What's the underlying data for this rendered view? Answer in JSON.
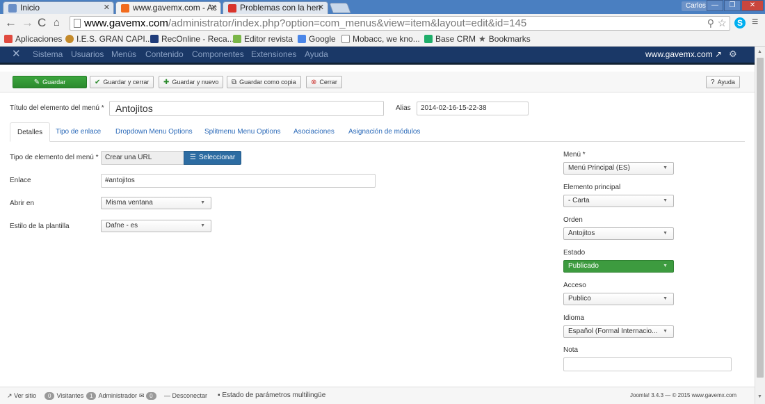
{
  "browser": {
    "tabs": [
      {
        "title": "Inicio",
        "fav_color": "#6a8fc7"
      },
      {
        "title": "www.gavemx.com - Ac",
        "fav_color": "#f26b1d"
      },
      {
        "title": "Problemas con la herr",
        "fav_color": "#d9342b"
      }
    ],
    "user": "Carlos",
    "window_buttons": [
      "—",
      "❐",
      "✕"
    ],
    "url_host": "www.gavemx.com",
    "url_rest": "/administrator/index.php?option=com_menus&view=item&layout=edit&id=145",
    "skype_label": "S",
    "bookmarks": [
      {
        "label": "Aplicaciones",
        "color": "#e04a3f"
      },
      {
        "label": "I.E.S. GRAN CAPI...",
        "color": "#c48a2a"
      },
      {
        "label": "RecOnline - Reca...",
        "color": "#1f3c7a"
      },
      {
        "label": "Editor revista",
        "color": "#7ab648"
      },
      {
        "label": "Google",
        "color": "#4a86e8"
      },
      {
        "label": "Mobacc, we kno...",
        "color": "#ffffff"
      },
      {
        "label": "Base CRM",
        "color": "#1fae6a"
      },
      {
        "label": "Bookmarks",
        "color": "#555555"
      }
    ]
  },
  "admin_nav": {
    "items": [
      "Sistema",
      "Usuarios",
      "Menús",
      "Contenido",
      "Componentes",
      "Extensiones",
      "Ayuda"
    ],
    "site": "www.gavemx.com"
  },
  "toolbar": {
    "save": "Guardar",
    "save_close": "Guardar y cerrar",
    "save_new": "Guardar y nuevo",
    "save_copy": "Guardar como copia",
    "close": "Cerrar",
    "help": "Ayuda"
  },
  "title_row": {
    "title_label": "Título del elemento del menú *",
    "title_value": "Antojitos",
    "alias_label": "Alias",
    "alias_value": "2014-02-16-15-22-38"
  },
  "tabs": [
    "Detalles",
    "Tipo de enlace",
    "Dropdown Menu Options",
    "Splitmenu Menu Options",
    "Asociaciones",
    "Asignación de módulos"
  ],
  "form": {
    "type_label": "Tipo de elemento del menú *",
    "type_value": "Crear una URL",
    "select_button": "Seleccionar",
    "link_label": "Enlace",
    "link_value": "#antojitos",
    "open_label": "Abrir en",
    "open_value": "Misma ventana",
    "style_label": "Estilo de la plantilla",
    "style_value": "Dafne - es"
  },
  "sidebar": {
    "menu_label": "Menú *",
    "menu_value": "Menú Principal (ES)",
    "parent_label": "Elemento principal",
    "parent_value": "- Carta",
    "order_label": "Orden",
    "order_value": "Antojitos",
    "status_label": "Estado",
    "status_value": "Publicado",
    "access_label": "Acceso",
    "access_value": "Publico",
    "language_label": "Idioma",
    "language_value": "Español (Formal Internacio...",
    "note_label": "Nota",
    "note_value": ""
  },
  "statusbar": {
    "view_site": "Ver sitio",
    "visitors_count": "0",
    "visitors": "Visitantes",
    "admin_count": "1",
    "admin": "Administrador",
    "mail_count": "0",
    "logout": "Desconectar",
    "multilang": "Estado de parámetros multilingüe",
    "version": "Joomla! 3.4.3 — © 2015 www.gavemx.com"
  },
  "colors": {
    "nav_bg": "#1a3867",
    "save_green": "#2b8a2d",
    "select_blue": "#2d6ca2",
    "link_blue": "#2a69b8"
  }
}
